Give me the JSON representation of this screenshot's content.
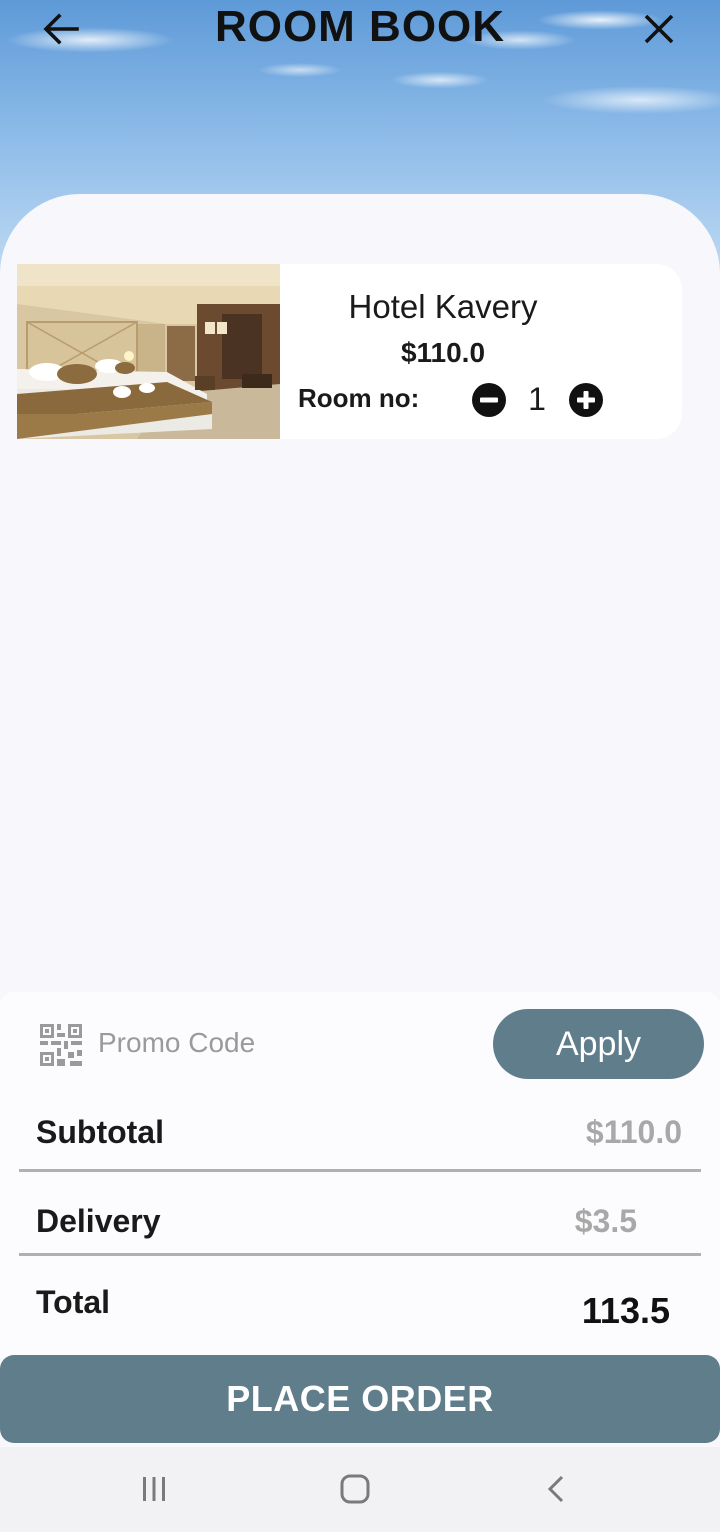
{
  "header": {
    "title": "ROOM BOOK",
    "back_icon": "arrow-left-icon",
    "close_icon": "close-icon"
  },
  "booking": {
    "hotel_name": "Hotel Kavery",
    "price": "$110.0",
    "room_label": "Room no:",
    "quantity": "1"
  },
  "promo": {
    "placeholder": "Promo Code",
    "apply_label": "Apply"
  },
  "summary": {
    "subtotal_label": "Subtotal",
    "subtotal_value": "$110.0",
    "delivery_label": "Delivery",
    "delivery_value": "$3.5",
    "total_label": "Total",
    "total_value": "113.5"
  },
  "actions": {
    "place_order_label": "PLACE ORDER"
  },
  "colors": {
    "accent": "#607d8b",
    "muted_text": "#a8a8a8"
  },
  "navbar": {
    "items": [
      "recent-apps-icon",
      "home-icon",
      "back-chevron-icon"
    ]
  }
}
